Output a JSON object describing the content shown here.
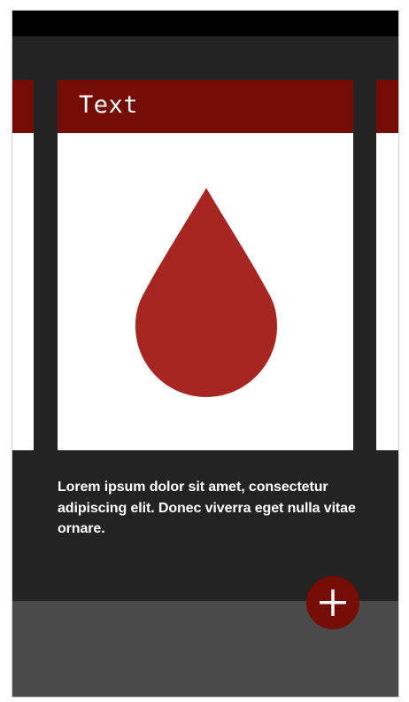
{
  "cards": {
    "main": {
      "title": "Text",
      "icon": "blood-drop-icon"
    },
    "header_color": "#730d05",
    "drop_color": "#a82621"
  },
  "description": "Lorem ipsum dolor sit amet, consectetur adipiscing elit. Donec viverra eget nulla vitae ornare.",
  "fab": {
    "icon": "plus-icon",
    "color": "#730d05"
  }
}
